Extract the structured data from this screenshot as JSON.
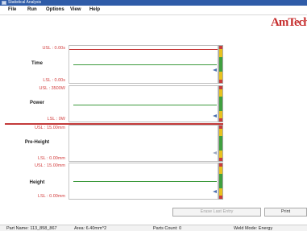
{
  "window": {
    "title": "Statistical Analysis"
  },
  "menu": {
    "items": [
      "File",
      "Run",
      "Options",
      "View",
      "Help"
    ]
  },
  "logo": {
    "text": "AmTech"
  },
  "panels": [
    {
      "title": "Time",
      "usl": "USL : 0.00s",
      "lsl": "LSL : 0.00s"
    },
    {
      "title": "Power",
      "usl": "USL : 3500W",
      "lsl": "LSL : 0W"
    },
    {
      "title": "Pre-Height",
      "usl": "USL : 15.00mm",
      "lsl": "LSL : 0.00mm"
    },
    {
      "title": "Height",
      "usl": "USL : 15.00mm",
      "lsl": "LSL : 0.00mm"
    }
  ],
  "buttons": {
    "erase": "Erase Last Entry",
    "print": "Print"
  },
  "status": {
    "part_name": "Part Name: 113_858_867",
    "area": "Area: 6.40mm^2",
    "parts_count": "Parts Count: 0",
    "weld_mode": "Weld Mode: Energy"
  },
  "colors": {
    "limit": "#c83c3c",
    "target": "#3d9a3d",
    "titlebar": "#2f5ca8",
    "logo": "#c62d2d"
  }
}
